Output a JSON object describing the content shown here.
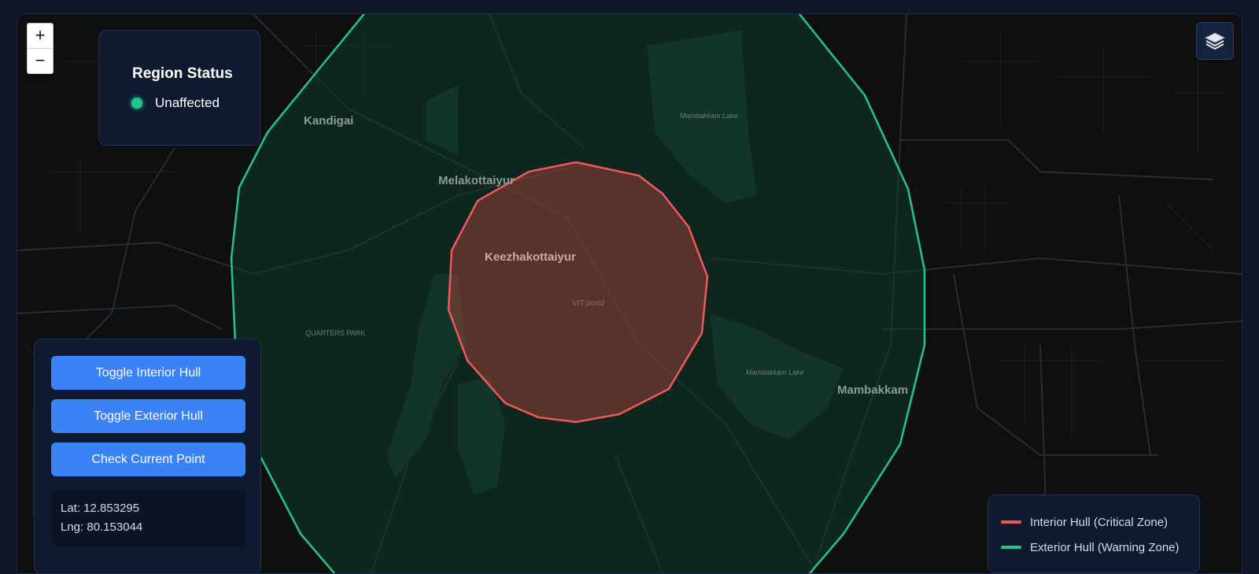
{
  "map": {
    "zoom_in_label": "+",
    "zoom_out_label": "−",
    "places": [
      {
        "name": "Kandigai"
      },
      {
        "name": "Melakottaiyur"
      },
      {
        "name": "Keezhakottaiyur"
      },
      {
        "name": "Mambakkam"
      },
      {
        "name": "VIT pond"
      },
      {
        "name": "QUARTERS PARK"
      },
      {
        "name": "Mambakkam Lake"
      },
      {
        "name": "Mambakkam Lake"
      }
    ]
  },
  "status_panel": {
    "title": "Region Status",
    "status_text": "Unaffected",
    "status_color": "#22c58b"
  },
  "controls": {
    "toggle_interior_label": "Toggle Interior Hull",
    "toggle_exterior_label": "Toggle Exterior Hull",
    "check_point_label": "Check Current Point",
    "lat_text": "Lat: 12.853295",
    "lng_text": "Lng: 80.153044",
    "button_color": "#3b82f6"
  },
  "legend": {
    "interior_label": "Interior Hull (Critical Zone)",
    "interior_color": "#f0595a",
    "exterior_label": "Exterior Hull (Warning Zone)",
    "exterior_color": "#22c58b"
  },
  "icons": {
    "layers": "layers-icon",
    "status": "status-dot-icon"
  }
}
